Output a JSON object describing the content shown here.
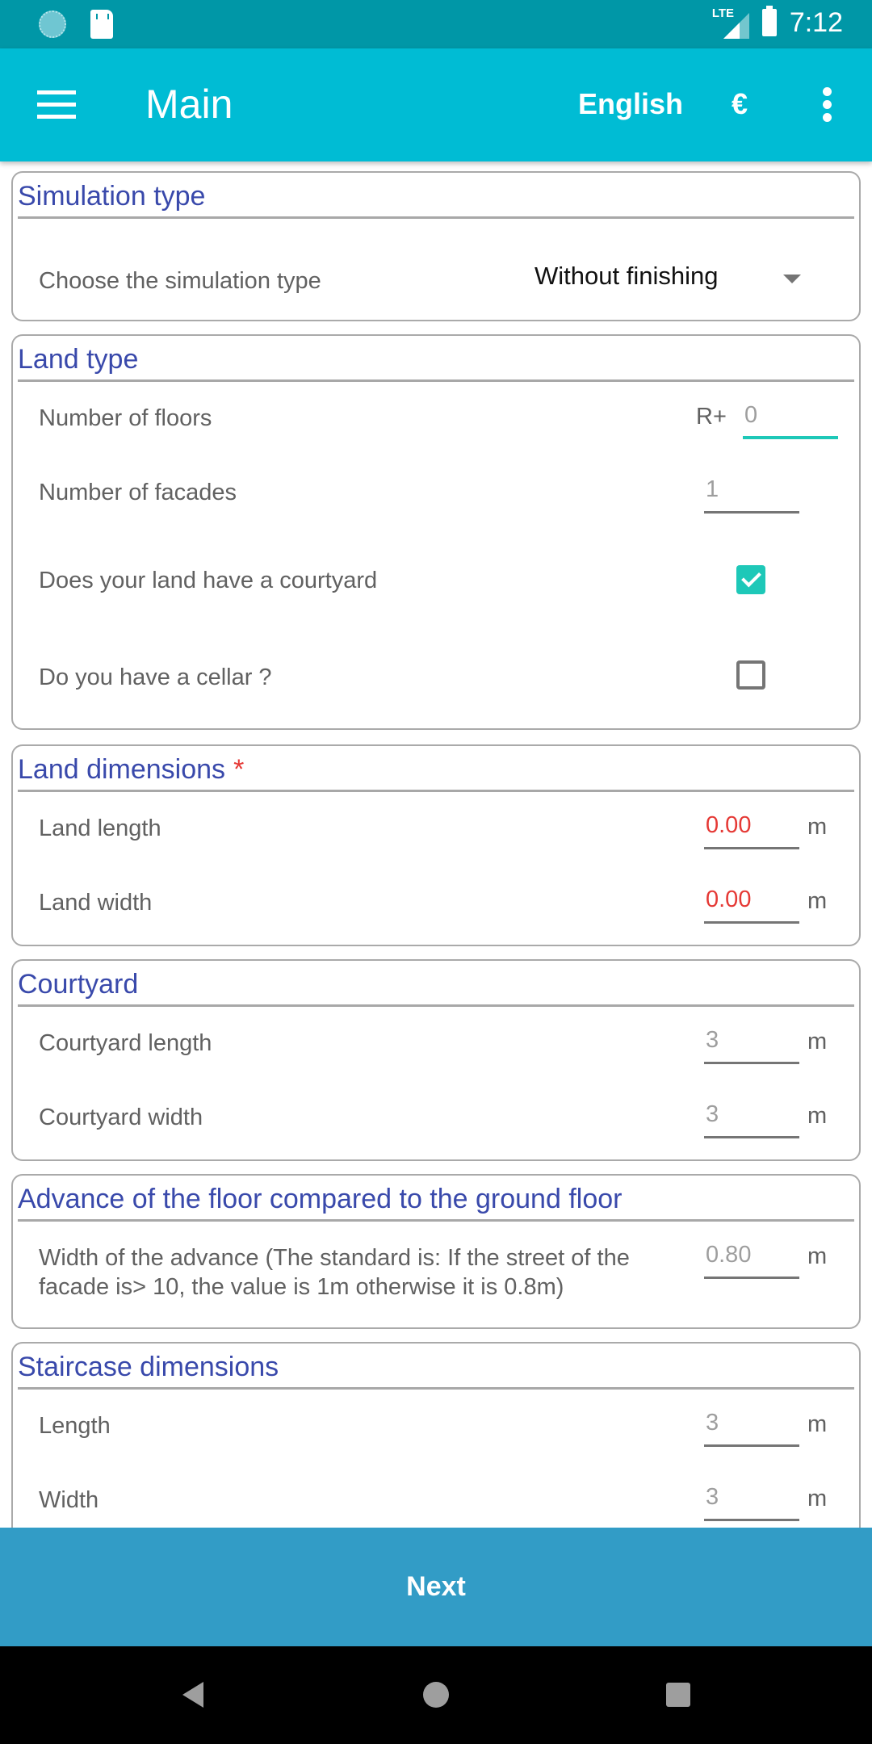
{
  "status_bar": {
    "time": "7:12",
    "network": "LTE",
    "icons": [
      "sync-icon",
      "sd-card-icon",
      "signal-icon",
      "battery-icon"
    ]
  },
  "app_bar": {
    "title": "Main",
    "language": "English",
    "currency": "€",
    "menu_icon": "hamburger-menu-icon",
    "overflow_icon": "more-vert-icon"
  },
  "sections": {
    "simulation_type": {
      "title": "Simulation type",
      "label": "Choose the simulation type",
      "selected": "Without finishing"
    },
    "land_type": {
      "title": "Land type",
      "floors_label": "Number of floors",
      "floors_prefix": "R+",
      "floors_value": "0",
      "facades_label": "Number of facades",
      "facades_value": "1",
      "courtyard_label": "Does your land have a courtyard",
      "courtyard_checked": true,
      "cellar_label": "Do you have a cellar ?",
      "cellar_checked": false
    },
    "land_dimensions": {
      "title": "Land dimensions",
      "required_mark": "*",
      "length_label": "Land length",
      "length_value": "0.00",
      "width_label": "Land width",
      "width_value": "0.00",
      "unit": "m"
    },
    "courtyard": {
      "title": "Courtyard",
      "length_label": "Courtyard length",
      "length_value": "3",
      "width_label": "Courtyard width",
      "width_value": "3",
      "unit": "m"
    },
    "advance": {
      "title": "Advance of the floor compared to the ground floor",
      "label": "Width of the advance (The standard is: If the street of the facade is> 10, the value is 1m otherwise it is 0.8m)",
      "value": "0.80",
      "unit": "m"
    },
    "staircase": {
      "title": "Staircase dimensions",
      "length_label": "Length",
      "length_value": "3",
      "width_label": "Width",
      "width_value": "3",
      "unit": "m"
    }
  },
  "footer": {
    "next_label": "Next"
  },
  "colors": {
    "status_bar": "#0097a7",
    "app_bar": "#00bcd4",
    "section_title": "#3949ab",
    "accent": "#1ec8b8",
    "error": "#e53935",
    "next_button": "#329cc6"
  }
}
